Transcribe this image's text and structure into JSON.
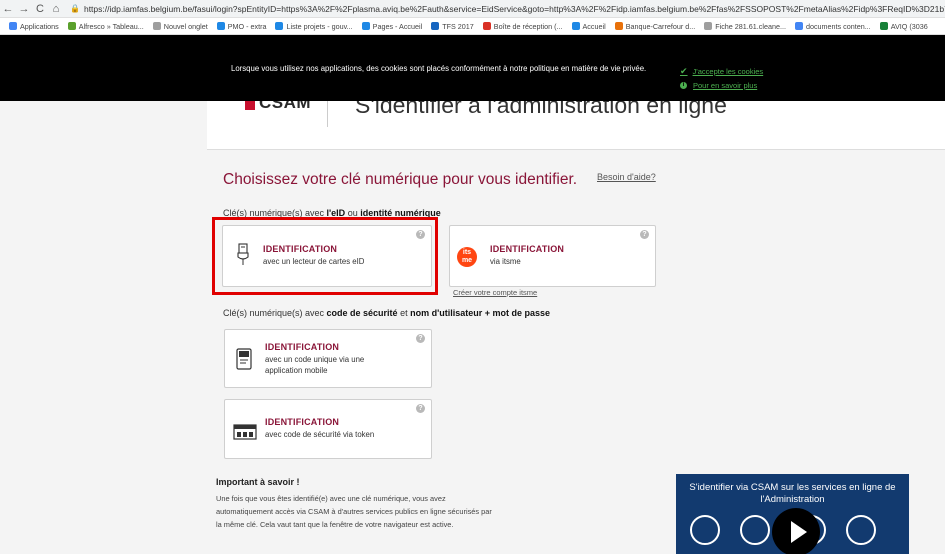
{
  "browser": {
    "url": "https://idp.iamfas.belgium.be/fasui/login?spEntityID=https%3A%2F%2Fplasma.aviq.be%2Fauth&service=EidService&goto=http%3A%2F%2Fidp.iamfas.belgium.be%2Ffas%2FSSOPOST%2FmetaAlias%2Fidp%3FReqID%3D21b745ed-f297-4",
    "bookmarks": [
      {
        "label": "Applications",
        "color": "#4285f4"
      },
      {
        "label": "Alfresco » Tableau...",
        "color": "#5aa02c"
      },
      {
        "label": "Nouvel onglet",
        "color": "#9e9e9e"
      },
      {
        "label": "PMO - extra",
        "color": "#1e88e5"
      },
      {
        "label": "Liste projets - gouv...",
        "color": "#1e88e5"
      },
      {
        "label": "Pages - Accueil",
        "color": "#1e88e5"
      },
      {
        "label": "TFS 2017",
        "color": "#1565c0"
      },
      {
        "label": "Boîte de réception (...",
        "color": "#d93025"
      },
      {
        "label": "Accueil",
        "color": "#1e88e5"
      },
      {
        "label": "Banque-Carrefour d...",
        "color": "#e8710a"
      },
      {
        "label": "Fiche 281.61.cleane...",
        "color": "#9e9e9e"
      },
      {
        "label": "documents conten...",
        "color": "#4285f4"
      },
      {
        "label": "AVIQ (3036",
        "color": "#188038"
      }
    ]
  },
  "cookie": {
    "message": "Lorsque vous utilisez nos applications, des cookies sont placés conformément à notre politique en matière de vie privée.",
    "accept": "J'accepte les cookies",
    "more": "Pour en savoir plus"
  },
  "header": {
    "logo": "CSAM",
    "title": "S'identifier à l'administration en ligne"
  },
  "main": {
    "title": "Choisissez votre clé numérique pour vous identifier.",
    "help": "Besoin d'aide?",
    "section1": {
      "pre": "Clé(s) numérique(s) avec ",
      "b1": "l'eID",
      "mid": " ou ",
      "b2": "identité numérique"
    },
    "section2": {
      "pre": "Clé(s) numérique(s) avec ",
      "b1": "code de sécurité",
      "mid": " et ",
      "b2": "nom d'utilisateur + mot de passe"
    },
    "cards": [
      {
        "title": "IDENTIFICATION",
        "subtitle": "avec un lecteur de cartes eID",
        "icon": "card-reader-icon"
      },
      {
        "title": "IDENTIFICATION",
        "subtitle": "via itsme",
        "icon": "itsme-logo",
        "badge": "its me"
      },
      {
        "title": "IDENTIFICATION",
        "subtitle": "avec un code unique via une application mobile",
        "icon": "mobile-app-icon"
      },
      {
        "title": "IDENTIFICATION",
        "subtitle": "avec code de sécurité via token",
        "icon": "token-icon"
      }
    ],
    "itsme_link": "Créer votre compte itsme",
    "help_icon": "?"
  },
  "important": {
    "title": "Important à savoir !",
    "body": "Une fois que vous êtes identifié(e) avec une clé numérique, vous avez automatiquement accès via CSAM à d'autres services publics en ligne sécurisés par la même clé. Cela vaut tant que la fenêtre de votre navigateur est active."
  },
  "video": {
    "title": "S'identifier via CSAM sur les services en ligne de l'Administration"
  },
  "colors": {
    "accent": "#8a1538",
    "highlight": "#e00000",
    "cookie_link": "#4caf50",
    "video_bg": "#123a6f"
  }
}
